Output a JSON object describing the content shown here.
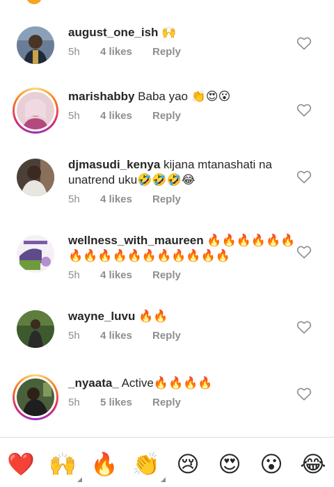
{
  "comments": [
    {
      "username": "august_one_ish",
      "text": "🙌",
      "time": "5h",
      "likes": "4 likes",
      "reply": "Reply",
      "story": false
    },
    {
      "username": "marishabby",
      "text": "Baba yao 👏😍😮",
      "time": "5h",
      "likes": "4 likes",
      "reply": "Reply",
      "story": true
    },
    {
      "username": "djmasudi_kenya",
      "text": "kijana mtanashati na unatrend uku🤣🤣🤣😂",
      "time": "5h",
      "likes": "4 likes",
      "reply": "Reply",
      "story": false
    },
    {
      "username": "wellness_with_maureen",
      "text": "🔥🔥🔥🔥🔥🔥🔥🔥🔥🔥🔥🔥🔥🔥🔥🔥🔥",
      "time": "5h",
      "likes": "4 likes",
      "reply": "Reply",
      "story": false
    },
    {
      "username": "wayne_luvu",
      "text": "🔥🔥",
      "time": "5h",
      "likes": "4 likes",
      "reply": "Reply",
      "story": false
    },
    {
      "username": "_nyaata_",
      "text": "Active🔥🔥🔥🔥",
      "time": "5h",
      "likes": "5 likes",
      "reply": "Reply",
      "story": true
    }
  ],
  "emoji_bar": {
    "emojis": [
      "❤️",
      "🙌",
      "🔥",
      "👏",
      "😢",
      "😍",
      "😮",
      "😂"
    ]
  },
  "colors": {
    "text": "#262626",
    "meta": "#8e8e8e",
    "divider": "#dbdbdb"
  }
}
